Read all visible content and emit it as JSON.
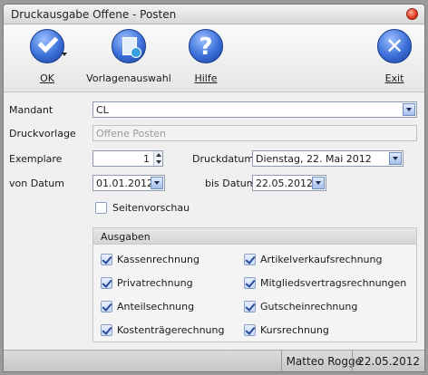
{
  "window": {
    "title": "Druckausgabe Offene - Posten"
  },
  "toolbar": {
    "ok": {
      "label": "OK",
      "icon": "check-icon"
    },
    "templates": {
      "label": "Vorlagenauswahl",
      "icon": "document-icon"
    },
    "help": {
      "label": "Hilfe",
      "icon": "help-icon"
    },
    "exit": {
      "label": "Exit",
      "icon": "close-icon"
    }
  },
  "form": {
    "mandant": {
      "label": "Mandant",
      "value": "CL"
    },
    "druckvorlage": {
      "label": "Druckvorlage",
      "value": "Offene Posten"
    },
    "exemplare": {
      "label": "Exemplare",
      "value": "1"
    },
    "druckdatum": {
      "label": "Druckdatum",
      "value": "Dienstag, 22. Mai 2012"
    },
    "von_datum": {
      "label": "von Datum",
      "value": "01.01.2012"
    },
    "bis_datum": {
      "label": "bis Datum",
      "value": "22.05.2012"
    },
    "seitenvorschau": {
      "label": "Seitenvorschau",
      "checked": false
    }
  },
  "ausgaben": {
    "title": "Ausgaben",
    "left": [
      {
        "label": "Kassenrechnung",
        "checked": true
      },
      {
        "label": "Privatrechnung",
        "checked": true
      },
      {
        "label": "Anteilsechnung",
        "checked": true
      },
      {
        "label": "Kostenträgerechnung",
        "checked": true
      }
    ],
    "right": [
      {
        "label": "Artikelverkaufsrechnung",
        "checked": true
      },
      {
        "label": "Mitgliedsvertragsrechnungen",
        "checked": true
      },
      {
        "label": "Gutscheinrechnung",
        "checked": true
      },
      {
        "label": "Kursrechnung",
        "checked": true
      }
    ]
  },
  "status": {
    "user": "Matteo Rogge",
    "date": "22.05.2012"
  },
  "colors": {
    "accent": "#3a6fd8",
    "close": "#e04020"
  }
}
